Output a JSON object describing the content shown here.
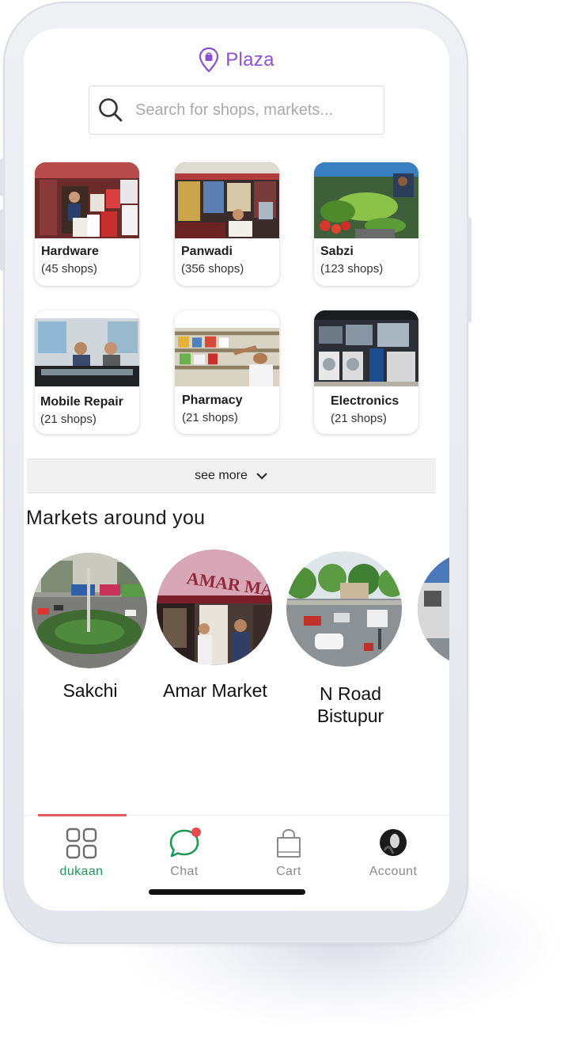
{
  "app": {
    "brand": "Plaza",
    "brand_color": "#8e4fd0",
    "brand_icon": "location-pin-bag-icon"
  },
  "search": {
    "placeholder": "Search for shops, markets...",
    "icon": "search-icon"
  },
  "categories": [
    {
      "name": "Hardware",
      "count": "(45 shops)"
    },
    {
      "name": "Panwadi",
      "count": "(356 shops)"
    },
    {
      "name": "Sabzi",
      "count": "(123 shops)"
    },
    {
      "name": "Mobile Repair",
      "count": "(21 shops)"
    },
    {
      "name": "Pharmacy",
      "count": "(21 shops)"
    },
    {
      "name": "Electronics",
      "count": "(21 shops)"
    }
  ],
  "see_more": {
    "label": "see more",
    "icon": "chevron-down-icon"
  },
  "markets_section": {
    "title": "Markets around you"
  },
  "markets": [
    {
      "name": "Sakchi"
    },
    {
      "name": "Amar Market",
      "sign_text": "AMAR MARKET"
    },
    {
      "name": "N Road Bistupur"
    }
  ],
  "bottom_nav": {
    "active_color": "#1e9a57",
    "indicator_color": "#e05a5f",
    "items": [
      {
        "label": "dukaan",
        "icon": "grid-icon",
        "active": true
      },
      {
        "label": "Chat",
        "icon": "chat-bubble-icon",
        "badge_color": "#e8474c"
      },
      {
        "label": "Cart",
        "icon": "shopping-bag-icon"
      },
      {
        "label": "Account",
        "icon": "avatar-icon"
      }
    ]
  }
}
